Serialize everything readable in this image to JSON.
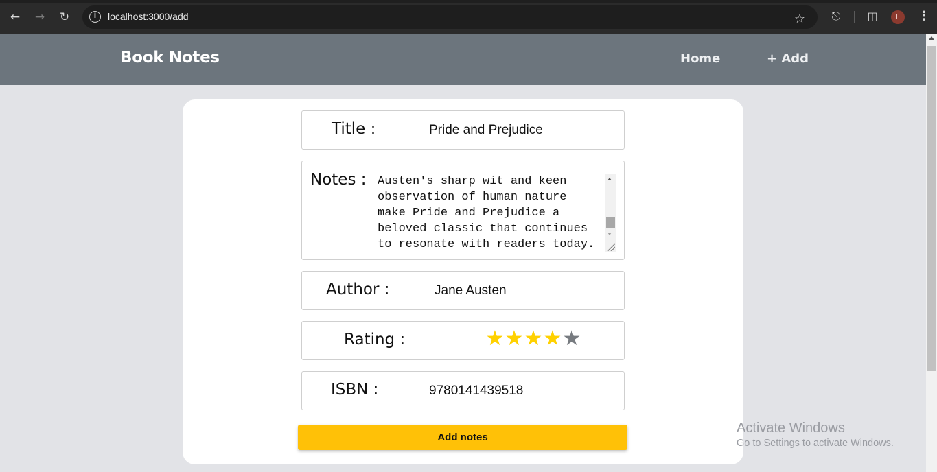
{
  "browser": {
    "url": "localhost:3000/add",
    "icons": {
      "back": "arrow-left-icon",
      "forward": "arrow-right-icon",
      "reload": "reload-icon",
      "site_info": "info-icon",
      "bookmark": "star-icon",
      "extensions": "puzzle-icon",
      "sidebar": "side-panel-icon",
      "menu": "kebab-menu-icon"
    },
    "profile_initial": "L"
  },
  "header": {
    "brand": "Book Notes",
    "nav": {
      "home": "Home",
      "add": "+ Add"
    },
    "background": "#6c757d"
  },
  "form": {
    "title": {
      "label": "Title :",
      "value": "Pride and Prejudice"
    },
    "notes": {
      "label": "Notes :",
      "value": "Austen's sharp wit and keen\nobservation of human nature\nmake Pride and Prejudice a\nbeloved classic that continues\nto resonate with readers today."
    },
    "author": {
      "label": "Author :",
      "value": "Jane Austen"
    },
    "rating": {
      "label": "Rating :",
      "value": 4,
      "max": 5,
      "filled_color": "#ffd100",
      "empty_color": "#777b80"
    },
    "isbn": {
      "label": "ISBN :",
      "value": "9780141439518"
    },
    "submit_label": "Add notes",
    "submit_color": "#ffc107"
  },
  "watermark": {
    "line1": "Activate Windows",
    "line2": "Go to Settings to activate Windows."
  }
}
